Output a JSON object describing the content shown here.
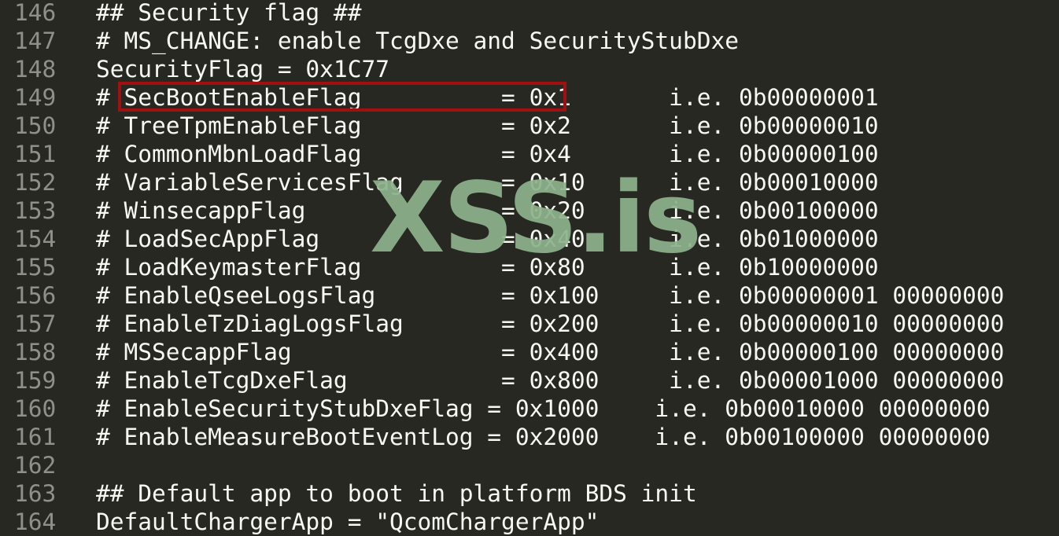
{
  "editor": {
    "lines": [
      {
        "number": "146",
        "text": "## Security flag ##"
      },
      {
        "number": "147",
        "text": "# MS_CHANGE: enable TcgDxe and SecurityStubDxe"
      },
      {
        "number": "148",
        "text": "SecurityFlag = 0x1C77"
      },
      {
        "number": "149",
        "text": "# SecBootEnableFlag          = 0x1       i.e. 0b00000001"
      },
      {
        "number": "150",
        "text": "# TreeTpmEnableFlag          = 0x2       i.e. 0b00000010"
      },
      {
        "number": "151",
        "text": "# CommonMbnLoadFlag          = 0x4       i.e. 0b00000100"
      },
      {
        "number": "152",
        "text": "# VariableServicesFlag       = 0x10      i.e. 0b00010000"
      },
      {
        "number": "153",
        "text": "# WinsecappFlag              = 0x20      i.e. 0b00100000"
      },
      {
        "number": "154",
        "text": "# LoadSecAppFlag             = 0x40      i.e. 0b01000000"
      },
      {
        "number": "155",
        "text": "# LoadKeymasterFlag          = 0x80      i.e. 0b10000000"
      },
      {
        "number": "156",
        "text": "# EnableQseeLogsFlag         = 0x100     i.e. 0b00000001 00000000"
      },
      {
        "number": "157",
        "text": "# EnableTzDiagLogsFlag       = 0x200     i.e. 0b00000010 00000000"
      },
      {
        "number": "158",
        "text": "# MSSecappFlag               = 0x400     i.e. 0b00000100 00000000"
      },
      {
        "number": "159",
        "text": "# EnableTcgDxeFlag           = 0x800     i.e. 0b00001000 00000000"
      },
      {
        "number": "160",
        "text": "# EnableSecurityStubDxeFlag = 0x1000    i.e. 0b00010000 00000000"
      },
      {
        "number": "161",
        "text": "# EnableMeasureBootEventLog = 0x2000    i.e. 0b00100000 00000000"
      },
      {
        "number": "162",
        "text": ""
      },
      {
        "number": "163",
        "text": "## Default app to boot in platform BDS init"
      },
      {
        "number": "164",
        "text": "DefaultChargerApp = \"QcomChargerApp\""
      }
    ]
  },
  "watermark": {
    "text": "XSS.is",
    "color": "#8eb28c"
  },
  "highlight": {
    "color": "#a01010",
    "line_number": "149"
  },
  "colors": {
    "background": "#272822",
    "foreground": "#f8f8f2",
    "gutter": "#8f908a"
  }
}
